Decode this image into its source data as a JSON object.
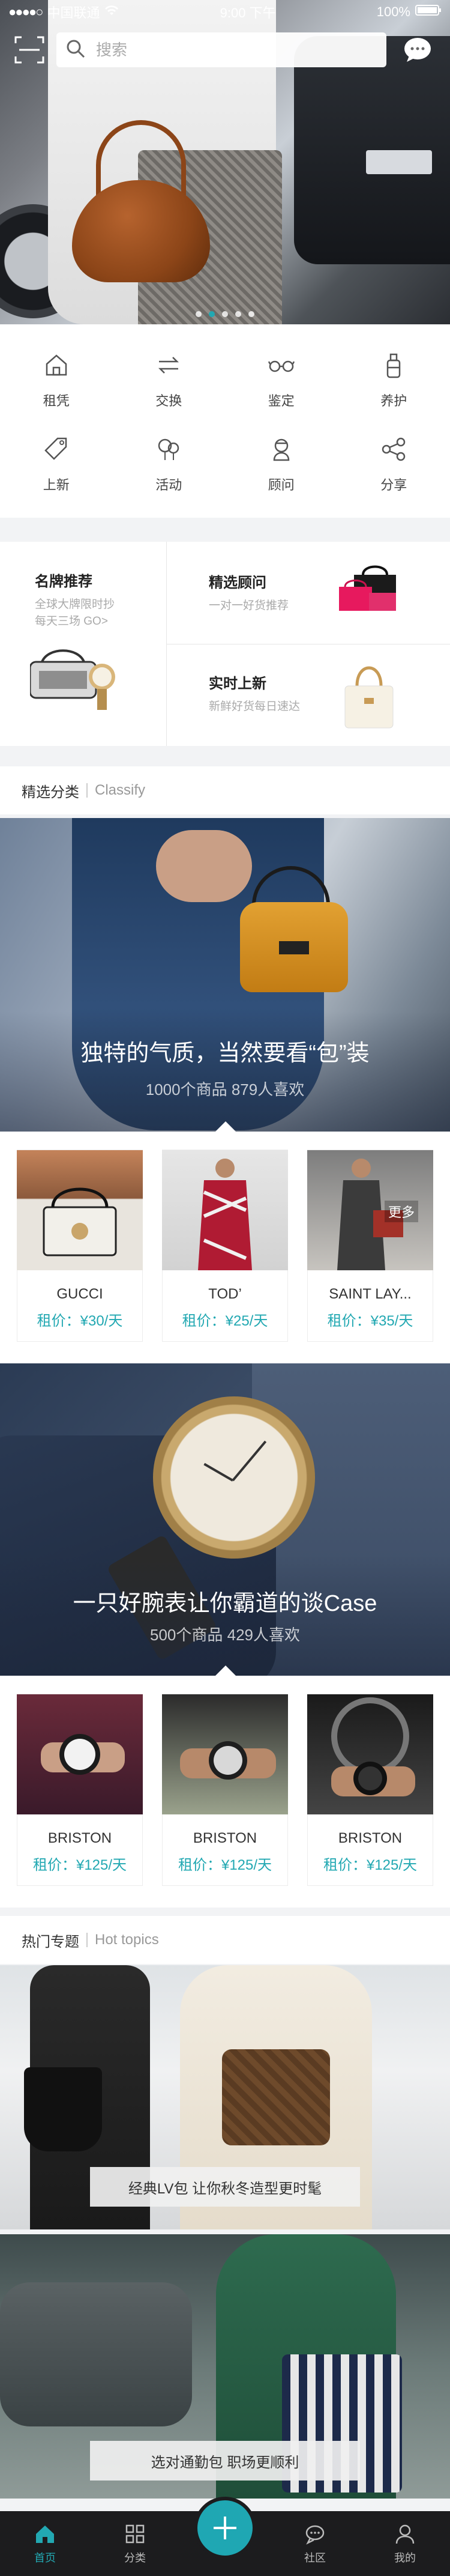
{
  "status_bar": {
    "carrier": "中国联通",
    "time": "9:00 下午",
    "battery": "100%"
  },
  "search": {
    "placeholder": "搜索"
  },
  "carousel": {
    "dot_count": 5,
    "active_index": 1
  },
  "categories": [
    {
      "label": "租凭",
      "icon": "home-icon"
    },
    {
      "label": "交换",
      "icon": "exchange-icon"
    },
    {
      "label": "鉴定",
      "icon": "glasses-icon"
    },
    {
      "label": "养护",
      "icon": "bottle-icon"
    },
    {
      "label": "上新",
      "icon": "tag-icon"
    },
    {
      "label": "活动",
      "icon": "balloon-icon"
    },
    {
      "label": "顾问",
      "icon": "advisor-icon"
    },
    {
      "label": "分享",
      "icon": "share-icon"
    }
  ],
  "promos": {
    "brand": {
      "title": "名牌推荐",
      "subtitle": "全球大牌限时抄\n每天三场 GO>"
    },
    "advisor": {
      "title": "精选顾问",
      "subtitle": "一对一好货推荐"
    },
    "new": {
      "title": "实时上新",
      "subtitle": "新鲜好货每日速达"
    }
  },
  "classify_section": {
    "title_cn": "精选分类",
    "title_en": "Classify"
  },
  "feature_bags": {
    "title": "独特的气质，当然要看“包”装",
    "meta": "1000个商品  879人喜欢"
  },
  "bag_products": [
    {
      "name": "GUCCI",
      "price": "租价：¥30/天"
    },
    {
      "name": "TOD’",
      "price": "租价：¥25/天"
    },
    {
      "name": "SAINT LAY...",
      "price": "租价：¥35/天",
      "badge": "更多"
    }
  ],
  "feature_watches": {
    "title": "一只好腕表让你霸道的谈Case",
    "meta": "500个商品  429人喜欢"
  },
  "watch_products": [
    {
      "name": "BRISTON",
      "price": "租价：¥125/天"
    },
    {
      "name": "BRISTON",
      "price": "租价：¥125/天"
    },
    {
      "name": "BRISTON",
      "price": "租价：¥125/天"
    }
  ],
  "hot_topics_section": {
    "title_cn": "热门专题",
    "title_en": "Hot topics"
  },
  "topics": [
    {
      "caption": "经典LV包 让你秋冬造型更时髦"
    },
    {
      "caption": "选对通勤包 职场更顺利"
    }
  ],
  "bottom_nav": [
    {
      "label": "首页",
      "icon": "home-icon",
      "active": true
    },
    {
      "label": "分类",
      "icon": "grid-icon",
      "active": false
    },
    {
      "label": "",
      "icon": "plus-icon",
      "active": false
    },
    {
      "label": "社区",
      "icon": "chat-icon",
      "active": false
    },
    {
      "label": "我的",
      "icon": "user-icon",
      "active": false
    }
  ],
  "colors": {
    "accent": "#22a8b2",
    "nav_bg": "#1c1c1e"
  }
}
